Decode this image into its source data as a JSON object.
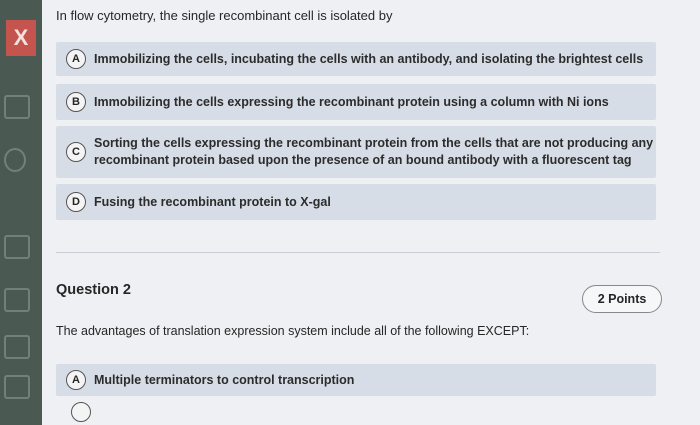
{
  "sidebar": {
    "close_label": "X"
  },
  "question1": {
    "prompt": "In flow cytometry, the single recombinant cell is isolated by",
    "options": [
      {
        "letter": "A",
        "text": "Immobilizing the cells, incubating the cells with an antibody, and isolating the brightest cells"
      },
      {
        "letter": "B",
        "text": "Immobilizing the cells expressing the recombinant protein using a column with Ni ions"
      },
      {
        "letter": "C",
        "text": "Sorting the cells expressing the recombinant protein from the cells that are not producing any recombinant protein based upon the presence of an bound antibody with a fluorescent tag"
      },
      {
        "letter": "D",
        "text": "Fusing the recombinant protein to X-gal"
      }
    ]
  },
  "question2": {
    "title": "Question 2",
    "points": "2 Points",
    "prompt": "The advantages of translation expression system include all of the following EXCEPT:",
    "options": [
      {
        "letter": "A",
        "text": "Multiple terminators to control transcription"
      }
    ]
  }
}
